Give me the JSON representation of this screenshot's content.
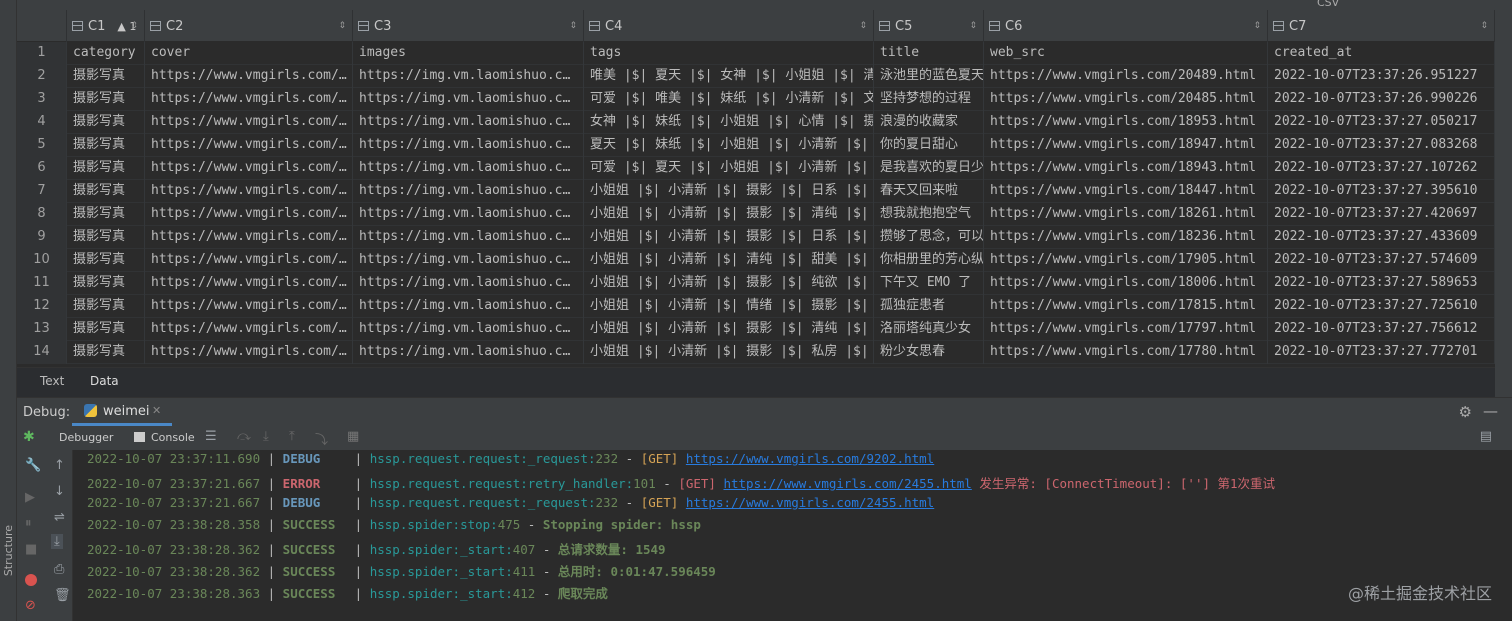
{
  "grid": {
    "columns": [
      {
        "label": "C1",
        "sort": "1",
        "w": 52
      },
      {
        "label": "C2",
        "w": 78
      },
      {
        "label": "C3",
        "w": 213
      },
      {
        "label": "C4",
        "w": 230
      },
      {
        "label": "C5",
        "w": 290
      },
      {
        "label": "C6",
        "w": 110
      },
      {
        "label": "C7",
        "w": 284
      }
    ],
    "rows": [
      {
        "n": "1",
        "c": [
          "category",
          "cover",
          "images",
          "tags",
          "title",
          "web_src",
          "created_at"
        ]
      },
      {
        "n": "2",
        "c": [
          "摄影写真",
          "https://www.vmgirls.com/…",
          "https://img.vm.laomishuo.c…",
          "唯美 |$| 夏天 |$| 女神 |$| 小姐姐 |$| 清",
          "泳池里的蓝色夏天",
          "https://www.vmgirls.com/20489.html",
          "2022-10-07T23:37:26.951227"
        ]
      },
      {
        "n": "3",
        "c": [
          "摄影写真",
          "https://www.vmgirls.com/…",
          "https://img.vm.laomishuo.c…",
          "可爱 |$| 唯美 |$| 妹纸 |$| 小清新 |$| 文",
          "坚持梦想的过程",
          "https://www.vmgirls.com/20485.html",
          "2022-10-07T23:37:26.990226"
        ]
      },
      {
        "n": "4",
        "c": [
          "摄影写真",
          "https://www.vmgirls.com/…",
          "https://img.vm.laomishuo.c…",
          "女神 |$| 妹纸 |$| 小姐姐 |$| 心情 |$| 摄",
          "浪漫的收藏家",
          "https://www.vmgirls.com/18953.html",
          "2022-10-07T23:37:27.050217"
        ]
      },
      {
        "n": "5",
        "c": [
          "摄影写真",
          "https://www.vmgirls.com/…",
          "https://img.vm.laomishuo.c…",
          "夏天 |$| 妹纸 |$| 小姐姐 |$| 小清新 |$|",
          "你的夏日甜心",
          "https://www.vmgirls.com/18947.html",
          "2022-10-07T23:37:27.083268"
        ]
      },
      {
        "n": "6",
        "c": [
          "摄影写真",
          "https://www.vmgirls.com/…",
          "https://img.vm.laomishuo.c…",
          "可爱 |$| 夏天 |$| 小姐姐 |$| 小清新 |$|",
          "是我喜欢的夏日少",
          "https://www.vmgirls.com/18943.html",
          "2022-10-07T23:37:27.107262"
        ]
      },
      {
        "n": "7",
        "c": [
          "摄影写真",
          "https://www.vmgirls.com/…",
          "https://img.vm.laomishuo.c…",
          "小姐姐 |$| 小清新 |$| 摄影 |$| 日系 |$|",
          "春天又回来啦",
          "https://www.vmgirls.com/18447.html",
          "2022-10-07T23:37:27.395610"
        ]
      },
      {
        "n": "8",
        "c": [
          "摄影写真",
          "https://www.vmgirls.com/…",
          "https://img.vm.laomishuo.c…",
          "小姐姐 |$| 小清新 |$| 摄影 |$| 清纯 |$|",
          "想我就抱抱空气",
          "https://www.vmgirls.com/18261.html",
          "2022-10-07T23:37:27.420697"
        ]
      },
      {
        "n": "9",
        "c": [
          "摄影写真",
          "https://www.vmgirls.com/…",
          "https://img.vm.laomishuo.c…",
          "小姐姐 |$| 小清新 |$| 摄影 |$| 日系 |$|",
          "攒够了思念，可以",
          "https://www.vmgirls.com/18236.html",
          "2022-10-07T23:37:27.433609"
        ]
      },
      {
        "n": "10",
        "c": [
          "摄影写真",
          "https://www.vmgirls.com/…",
          "https://img.vm.laomishuo.c…",
          "小姐姐 |$| 小清新 |$| 清纯 |$| 甜美 |$|",
          "你相册里的芳心纵",
          "https://www.vmgirls.com/17905.html",
          "2022-10-07T23:37:27.574609"
        ]
      },
      {
        "n": "11",
        "c": [
          "摄影写真",
          "https://www.vmgirls.com/…",
          "https://img.vm.laomishuo.c…",
          "小姐姐 |$| 小清新 |$| 摄影 |$| 纯欲 |$|",
          "下午又 EMO 了",
          "https://www.vmgirls.com/18006.html",
          "2022-10-07T23:37:27.589653"
        ]
      },
      {
        "n": "12",
        "c": [
          "摄影写真",
          "https://www.vmgirls.com/…",
          "https://img.vm.laomishuo.c…",
          "小姐姐 |$| 小清新 |$| 情绪 |$| 摄影 |$|",
          "孤独症患者",
          "https://www.vmgirls.com/17815.html",
          "2022-10-07T23:37:27.725610"
        ]
      },
      {
        "n": "13",
        "c": [
          "摄影写真",
          "https://www.vmgirls.com/…",
          "https://img.vm.laomishuo.c…",
          "小姐姐 |$| 小清新 |$| 摄影 |$| 清纯 |$|",
          "洛丽塔纯真少女",
          "https://www.vmgirls.com/17797.html",
          "2022-10-07T23:37:27.756612"
        ]
      },
      {
        "n": "14",
        "c": [
          "摄影写真",
          "https://www.vmgirls.com/…",
          "https://img.vm.laomishuo.c…",
          "小姐姐 |$| 小清新 |$| 摄影 |$| 私房 |$|",
          "粉少女思春",
          "https://www.vmgirls.com/17780.html",
          "2022-10-07T23:37:27.772701"
        ]
      }
    ]
  },
  "tabs": {
    "text": "Text",
    "data": "Data"
  },
  "debug": {
    "label": "Debug:",
    "session": "weimei",
    "debugger": "Debugger",
    "console": "Console"
  },
  "log": [
    {
      "ts": "2022-10-07 23:37:11.690",
      "lvl": "DEBUG",
      "mod": "hssp.request.request",
      "fn": "_request",
      "line": "232",
      "msg_pre": "[GET]",
      "url": "https://www.vmgirls.com/9202.html",
      "tail": ""
    },
    {
      "ts": "2022-10-07 23:37:21.667",
      "lvl": "ERROR",
      "mod": "hssp.request.request",
      "fn": "retry_handler",
      "line": "101",
      "msg_pre": "[GET]",
      "url": "https://www.vmgirls.com/2455.html",
      "tail": "发生异常: [ConnectTimeout]: [''] 第1次重试"
    },
    {
      "ts": "2022-10-07 23:37:21.667",
      "lvl": "DEBUG",
      "mod": "hssp.request.request",
      "fn": "_request",
      "line": "232",
      "msg_pre": "[GET]",
      "url": "https://www.vmgirls.com/2455.html",
      "tail": ""
    },
    {
      "ts": "2022-10-07 23:38:28.358",
      "lvl": "SUCCESS",
      "mod": "hssp.spider",
      "fn": "stop",
      "line": "475",
      "msg_pre": "Stopping spider: hssp",
      "url": "",
      "tail": ""
    },
    {
      "ts": "2022-10-07 23:38:28.362",
      "lvl": "SUCCESS",
      "mod": "hssp.spider",
      "fn": "_start",
      "line": "407",
      "msg_pre": "总请求数量: 1549",
      "url": "",
      "tail": ""
    },
    {
      "ts": "2022-10-07 23:38:28.362",
      "lvl": "SUCCESS",
      "mod": "hssp.spider",
      "fn": "_start",
      "line": "411",
      "msg_pre": "总用时: 0:01:47.596459",
      "url": "",
      "tail": ""
    },
    {
      "ts": "2022-10-07 23:38:28.363",
      "lvl": "SUCCESS",
      "mod": "hssp.spider",
      "fn": "_start",
      "line": "412",
      "msg_pre": "爬取完成",
      "url": "",
      "tail": ""
    }
  ],
  "side_labels": {
    "structure": "Structure"
  },
  "watermark": "@稀土掘金技术社区",
  "csv_label": "CSV"
}
